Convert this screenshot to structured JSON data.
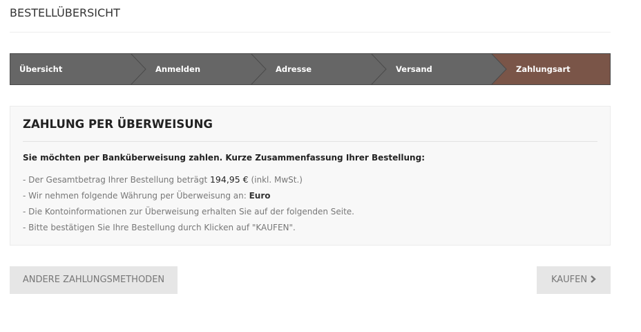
{
  "header": {
    "title": "BESTELLÜBERSICHT"
  },
  "steps": {
    "items": [
      {
        "label": "Übersicht",
        "active": false
      },
      {
        "label": "Anmelden",
        "active": false
      },
      {
        "label": "Adresse",
        "active": false
      },
      {
        "label": "Versand",
        "active": false
      },
      {
        "label": "Zahlungsart",
        "active": true
      }
    ],
    "colors": {
      "inactive": "#666666",
      "active": "#7a5548",
      "border": "#4a4a4a"
    }
  },
  "payment": {
    "title": "ZAHLUNG PER ÜBERWEISUNG",
    "intro": "Sie möchten per Banküberweisung zahlen. Kurze Zusammenfassung Ihrer Bestellung:",
    "line1_prefix": "- Der Gesamtbetrag Ihrer Bestellung beträgt ",
    "line1_amount": "194,95 €",
    "line1_suffix": " (inkl. MwSt.)",
    "line2_prefix": "- Wir nehmen folgende Währung per Überweisung an: ",
    "line2_currency": "Euro",
    "line3": "- Die Kontoinformationen zur Überweisung erhalten Sie auf der folgenden Seite.",
    "line4": "- Bitte bestätigen Sie Ihre Bestellung durch Klicken auf \"KAUFEN\"."
  },
  "actions": {
    "other_methods_label": "ANDERE ZAHLUNGSMETHODEN",
    "buy_label": "KAUFEN",
    "buy_icon": "chevron-right-icon"
  }
}
